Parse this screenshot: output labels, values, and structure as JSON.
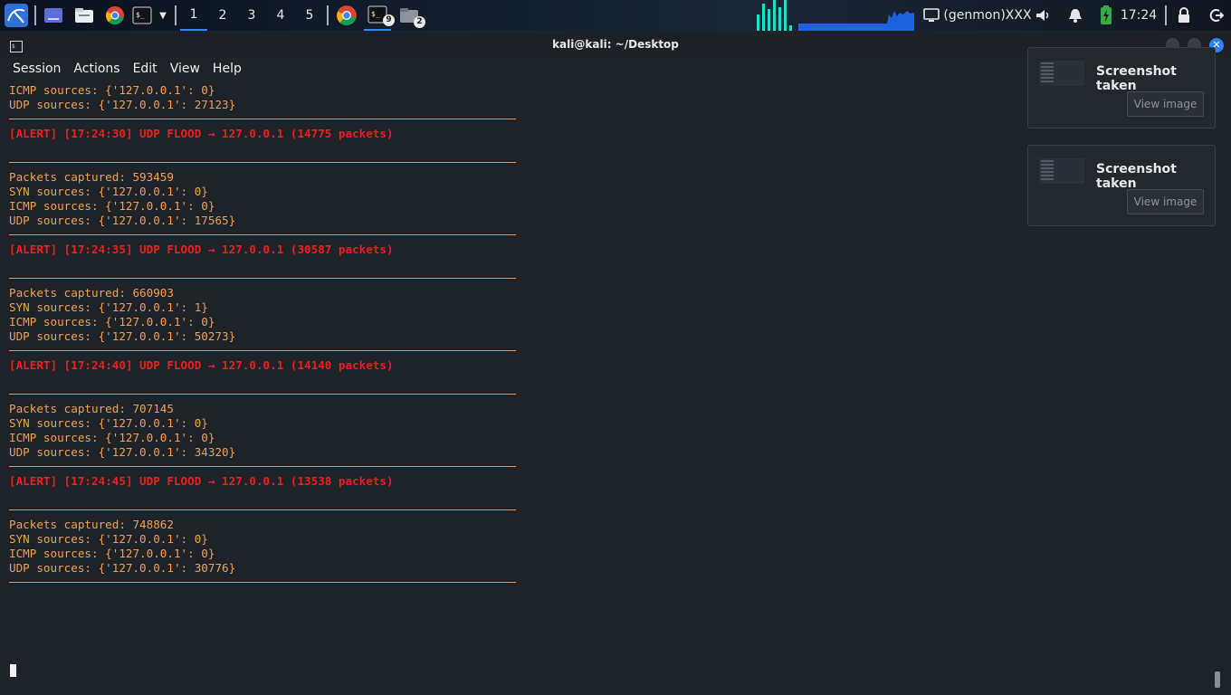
{
  "panel": {
    "workspaces": [
      "1",
      "2",
      "3",
      "4",
      "5"
    ],
    "badge_terminals": "9",
    "badge_files": "2",
    "genmon": "(genmon)XXX",
    "clock": "17:24"
  },
  "window": {
    "title": "kali@kali: ~/Desktop",
    "menu": [
      "Session",
      "Actions",
      "Edit",
      "View",
      "Help"
    ]
  },
  "terminal": {
    "top": [
      "ICMP sources: {'127.0.0.1': 0}",
      "UDP sources: {'127.0.0.1': 27123}"
    ],
    "blocks": [
      {
        "alert": "[ALERT] [17:24:30] UDP FLOOD → 127.0.0.1 (14775 packets)",
        "lines": [
          "Packets captured: 593459",
          "SYN sources: {'127.0.0.1': 0}",
          "ICMP sources: {'127.0.0.1': 0}",
          "UDP sources: {'127.0.0.1': 17565}"
        ]
      },
      {
        "alert": "[ALERT] [17:24:35] UDP FLOOD → 127.0.0.1 (30587 packets)",
        "lines": [
          "Packets captured: 660903",
          "SYN sources: {'127.0.0.1': 1}",
          "ICMP sources: {'127.0.0.1': 0}",
          "UDP sources: {'127.0.0.1': 50273}"
        ]
      },
      {
        "alert": "[ALERT] [17:24:40] UDP FLOOD → 127.0.0.1 (14140 packets)",
        "lines": [
          "Packets captured: 707145",
          "SYN sources: {'127.0.0.1': 0}",
          "ICMP sources: {'127.0.0.1': 0}",
          "UDP sources: {'127.0.0.1': 34320}"
        ]
      },
      {
        "alert": "[ALERT] [17:24:45] UDP FLOOD → 127.0.0.1 (13538 packets)",
        "lines": [
          "Packets captured: 748862",
          "SYN sources: {'127.0.0.1': 0}",
          "ICMP sources: {'127.0.0.1': 0}",
          "UDP sources: {'127.0.0.1': 30776}"
        ]
      }
    ]
  },
  "notifications": [
    {
      "title": "Screenshot taken",
      "button": "View image"
    },
    {
      "title": "Screenshot taken",
      "button": "View image"
    }
  ],
  "colors": {
    "output": "#f5a048",
    "alert": "#f01f1f",
    "accent": "#3a86ff",
    "graph": "#19e0c8"
  }
}
